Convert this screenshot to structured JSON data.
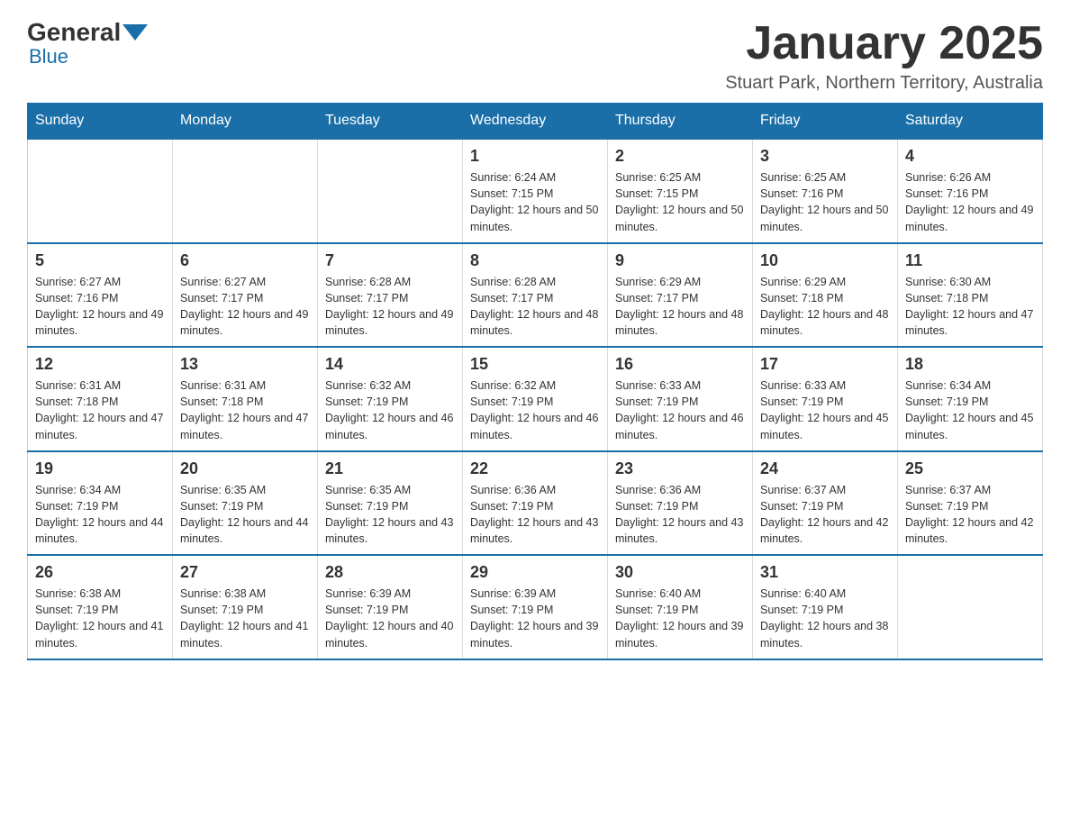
{
  "header": {
    "logo_general": "General",
    "logo_blue": "Blue",
    "month_title": "January 2025",
    "location": "Stuart Park, Northern Territory, Australia"
  },
  "days_of_week": [
    "Sunday",
    "Monday",
    "Tuesday",
    "Wednesday",
    "Thursday",
    "Friday",
    "Saturday"
  ],
  "weeks": [
    [
      {
        "day": "",
        "info": ""
      },
      {
        "day": "",
        "info": ""
      },
      {
        "day": "",
        "info": ""
      },
      {
        "day": "1",
        "info": "Sunrise: 6:24 AM\nSunset: 7:15 PM\nDaylight: 12 hours and 50 minutes."
      },
      {
        "day": "2",
        "info": "Sunrise: 6:25 AM\nSunset: 7:15 PM\nDaylight: 12 hours and 50 minutes."
      },
      {
        "day": "3",
        "info": "Sunrise: 6:25 AM\nSunset: 7:16 PM\nDaylight: 12 hours and 50 minutes."
      },
      {
        "day": "4",
        "info": "Sunrise: 6:26 AM\nSunset: 7:16 PM\nDaylight: 12 hours and 49 minutes."
      }
    ],
    [
      {
        "day": "5",
        "info": "Sunrise: 6:27 AM\nSunset: 7:16 PM\nDaylight: 12 hours and 49 minutes."
      },
      {
        "day": "6",
        "info": "Sunrise: 6:27 AM\nSunset: 7:17 PM\nDaylight: 12 hours and 49 minutes."
      },
      {
        "day": "7",
        "info": "Sunrise: 6:28 AM\nSunset: 7:17 PM\nDaylight: 12 hours and 49 minutes."
      },
      {
        "day": "8",
        "info": "Sunrise: 6:28 AM\nSunset: 7:17 PM\nDaylight: 12 hours and 48 minutes."
      },
      {
        "day": "9",
        "info": "Sunrise: 6:29 AM\nSunset: 7:17 PM\nDaylight: 12 hours and 48 minutes."
      },
      {
        "day": "10",
        "info": "Sunrise: 6:29 AM\nSunset: 7:18 PM\nDaylight: 12 hours and 48 minutes."
      },
      {
        "day": "11",
        "info": "Sunrise: 6:30 AM\nSunset: 7:18 PM\nDaylight: 12 hours and 47 minutes."
      }
    ],
    [
      {
        "day": "12",
        "info": "Sunrise: 6:31 AM\nSunset: 7:18 PM\nDaylight: 12 hours and 47 minutes."
      },
      {
        "day": "13",
        "info": "Sunrise: 6:31 AM\nSunset: 7:18 PM\nDaylight: 12 hours and 47 minutes."
      },
      {
        "day": "14",
        "info": "Sunrise: 6:32 AM\nSunset: 7:19 PM\nDaylight: 12 hours and 46 minutes."
      },
      {
        "day": "15",
        "info": "Sunrise: 6:32 AM\nSunset: 7:19 PM\nDaylight: 12 hours and 46 minutes."
      },
      {
        "day": "16",
        "info": "Sunrise: 6:33 AM\nSunset: 7:19 PM\nDaylight: 12 hours and 46 minutes."
      },
      {
        "day": "17",
        "info": "Sunrise: 6:33 AM\nSunset: 7:19 PM\nDaylight: 12 hours and 45 minutes."
      },
      {
        "day": "18",
        "info": "Sunrise: 6:34 AM\nSunset: 7:19 PM\nDaylight: 12 hours and 45 minutes."
      }
    ],
    [
      {
        "day": "19",
        "info": "Sunrise: 6:34 AM\nSunset: 7:19 PM\nDaylight: 12 hours and 44 minutes."
      },
      {
        "day": "20",
        "info": "Sunrise: 6:35 AM\nSunset: 7:19 PM\nDaylight: 12 hours and 44 minutes."
      },
      {
        "day": "21",
        "info": "Sunrise: 6:35 AM\nSunset: 7:19 PM\nDaylight: 12 hours and 43 minutes."
      },
      {
        "day": "22",
        "info": "Sunrise: 6:36 AM\nSunset: 7:19 PM\nDaylight: 12 hours and 43 minutes."
      },
      {
        "day": "23",
        "info": "Sunrise: 6:36 AM\nSunset: 7:19 PM\nDaylight: 12 hours and 43 minutes."
      },
      {
        "day": "24",
        "info": "Sunrise: 6:37 AM\nSunset: 7:19 PM\nDaylight: 12 hours and 42 minutes."
      },
      {
        "day": "25",
        "info": "Sunrise: 6:37 AM\nSunset: 7:19 PM\nDaylight: 12 hours and 42 minutes."
      }
    ],
    [
      {
        "day": "26",
        "info": "Sunrise: 6:38 AM\nSunset: 7:19 PM\nDaylight: 12 hours and 41 minutes."
      },
      {
        "day": "27",
        "info": "Sunrise: 6:38 AM\nSunset: 7:19 PM\nDaylight: 12 hours and 41 minutes."
      },
      {
        "day": "28",
        "info": "Sunrise: 6:39 AM\nSunset: 7:19 PM\nDaylight: 12 hours and 40 minutes."
      },
      {
        "day": "29",
        "info": "Sunrise: 6:39 AM\nSunset: 7:19 PM\nDaylight: 12 hours and 39 minutes."
      },
      {
        "day": "30",
        "info": "Sunrise: 6:40 AM\nSunset: 7:19 PM\nDaylight: 12 hours and 39 minutes."
      },
      {
        "day": "31",
        "info": "Sunrise: 6:40 AM\nSunset: 7:19 PM\nDaylight: 12 hours and 38 minutes."
      },
      {
        "day": "",
        "info": ""
      }
    ]
  ]
}
